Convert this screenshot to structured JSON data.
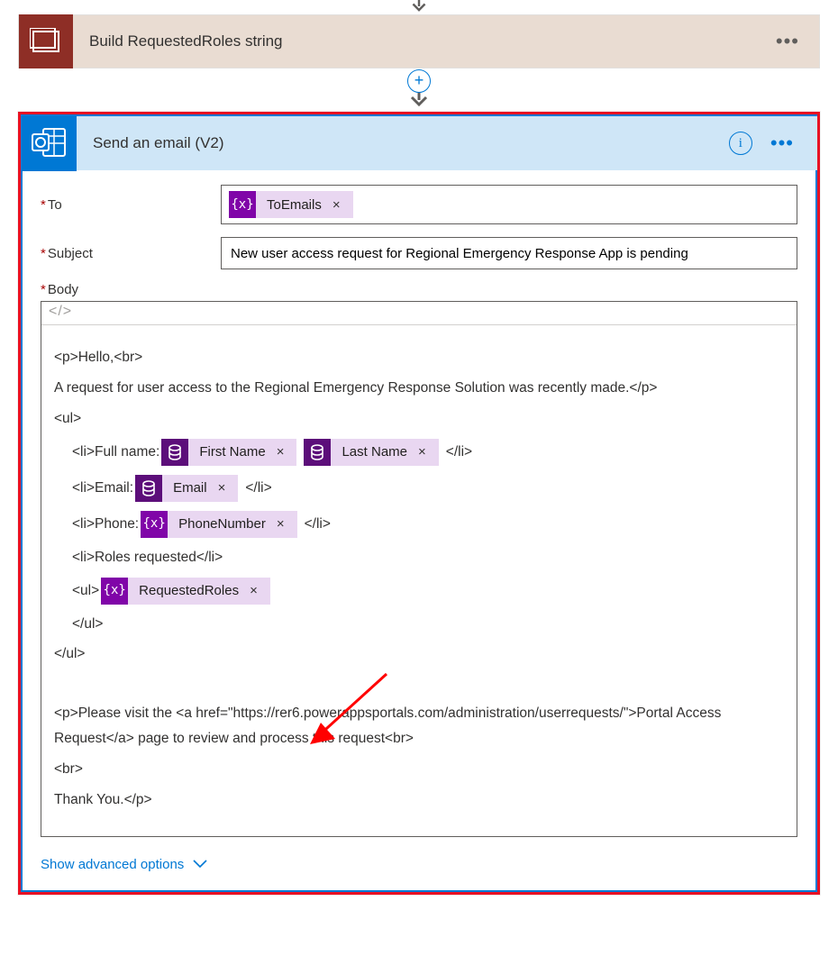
{
  "card1": {
    "title": "Build RequestedRoles string"
  },
  "emailCard": {
    "title": "Send an email (V2)"
  },
  "labels": {
    "to": "To",
    "subject": "Subject",
    "body": "Body",
    "advanced": "Show advanced options"
  },
  "values": {
    "subject": "New user access request for Regional Emergency Response App is pending"
  },
  "tokens": {
    "toEmails": "ToEmails",
    "firstName": "First Name",
    "lastName": "Last Name",
    "email": "Email",
    "phoneNumber": "PhoneNumber",
    "requestedRoles": "RequestedRoles"
  },
  "body": {
    "l1": "<p>Hello,<br>",
    "l2": "A request for user access to the Regional Emergency Response Solution was recently made.</p>",
    "l3": "<ul>",
    "l4a": "<li>Full name:",
    "l4b": " </li>",
    "l5a": "<li>Email:",
    "l5b": " </li>",
    "l6a": "<li>Phone:",
    "l6b": " </li>",
    "l7": "<li>Roles requested</li>",
    "l8a": "<ul>",
    "l9": "</ul>",
    "l10": "</ul>",
    "l11": "<p>Please visit the <a href=\"https://rer6.powerappsportals.com/administration/userrequests/\">Portal Access Request</a> page to review and process this request<br>",
    "l12": "<br>",
    "l13": "Thank You.</p>"
  },
  "toolbar": {
    "codeIcon": "</>"
  },
  "tokenIcons": {
    "fx": "{x}"
  }
}
